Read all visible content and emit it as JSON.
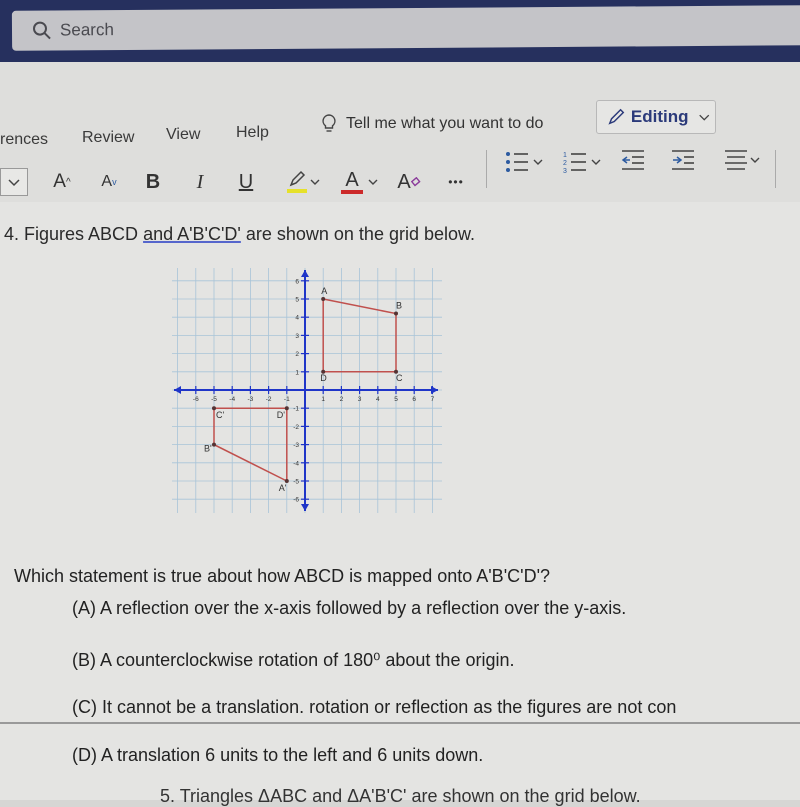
{
  "search": {
    "placeholder": "Search",
    "icon": "search-icon"
  },
  "ribbon": {
    "tabs": [
      "rences",
      "Review",
      "View",
      "Help"
    ],
    "tell_me": "Tell me what you want to do",
    "mode_button": "Editing",
    "tools": {
      "grow_font": "A",
      "shrink_font": "A",
      "bold": "B",
      "italic": "I",
      "underline": "U",
      "font_color": "A",
      "clear_format": "A",
      "more": "•••"
    },
    "colors": {
      "highlight": "#e6e12a",
      "font_color": "#cc2a2a",
      "accent": "#2b3a7a",
      "list_icon": "#2c5aa0"
    }
  },
  "document": {
    "q4_prefix": "4. Figures ABCD ",
    "q4_underlined": "and  A'B'C'D'",
    "q4_suffix": " are shown on the grid below.",
    "question": "Which statement is true about how ABCD is mapped onto A'B'C'D'?",
    "choices": [
      {
        "label": "(A)",
        "text": "A reflection over the x-axis followed by a reflection over the y-axis."
      },
      {
        "label": "(B)",
        "text": "A counterclockwise rotation of 180⁰ about the origin."
      },
      {
        "label": "(C)",
        "text": "It cannot be a translation. rotation or reflection as the figures are not con"
      },
      {
        "label": "(D)",
        "text": "A translation 6 units to the left and 6 units down."
      }
    ],
    "q5_partial": "5. Triangles ΔABC and  ΔA'B'C' are shown on the grid below."
  },
  "chart_data": {
    "type": "scatter",
    "title": "",
    "xlabel": "",
    "ylabel": "",
    "xlim": [
      -6,
      7
    ],
    "ylim": [
      -6,
      6
    ],
    "grid": true,
    "x_ticks": [
      -6,
      -5,
      -4,
      -3,
      -2,
      -1,
      1,
      2,
      3,
      4,
      5,
      6,
      7
    ],
    "y_ticks": [
      -6,
      -5,
      -4,
      -3,
      -2,
      -1,
      1,
      2,
      3,
      4,
      5,
      6
    ],
    "series": [
      {
        "name": "ABCD",
        "points": [
          {
            "label": "A",
            "x": 1,
            "y": 5
          },
          {
            "label": "B",
            "x": 5,
            "y": 4.2
          },
          {
            "label": "C",
            "x": 5,
            "y": 1
          },
          {
            "label": "D",
            "x": 1,
            "y": 1
          }
        ]
      },
      {
        "name": "A'B'C'D'",
        "points": [
          {
            "label": "A'",
            "x": -1,
            "y": -5
          },
          {
            "label": "B'",
            "x": -5,
            "y": -3
          },
          {
            "label": "C'",
            "x": -5,
            "y": -1
          },
          {
            "label": "D'",
            "x": -1,
            "y": -1
          }
        ]
      }
    ],
    "colors": {
      "axis": "#1f35c8",
      "shape": "#c0504d",
      "grid": "#a8c4d8"
    }
  }
}
